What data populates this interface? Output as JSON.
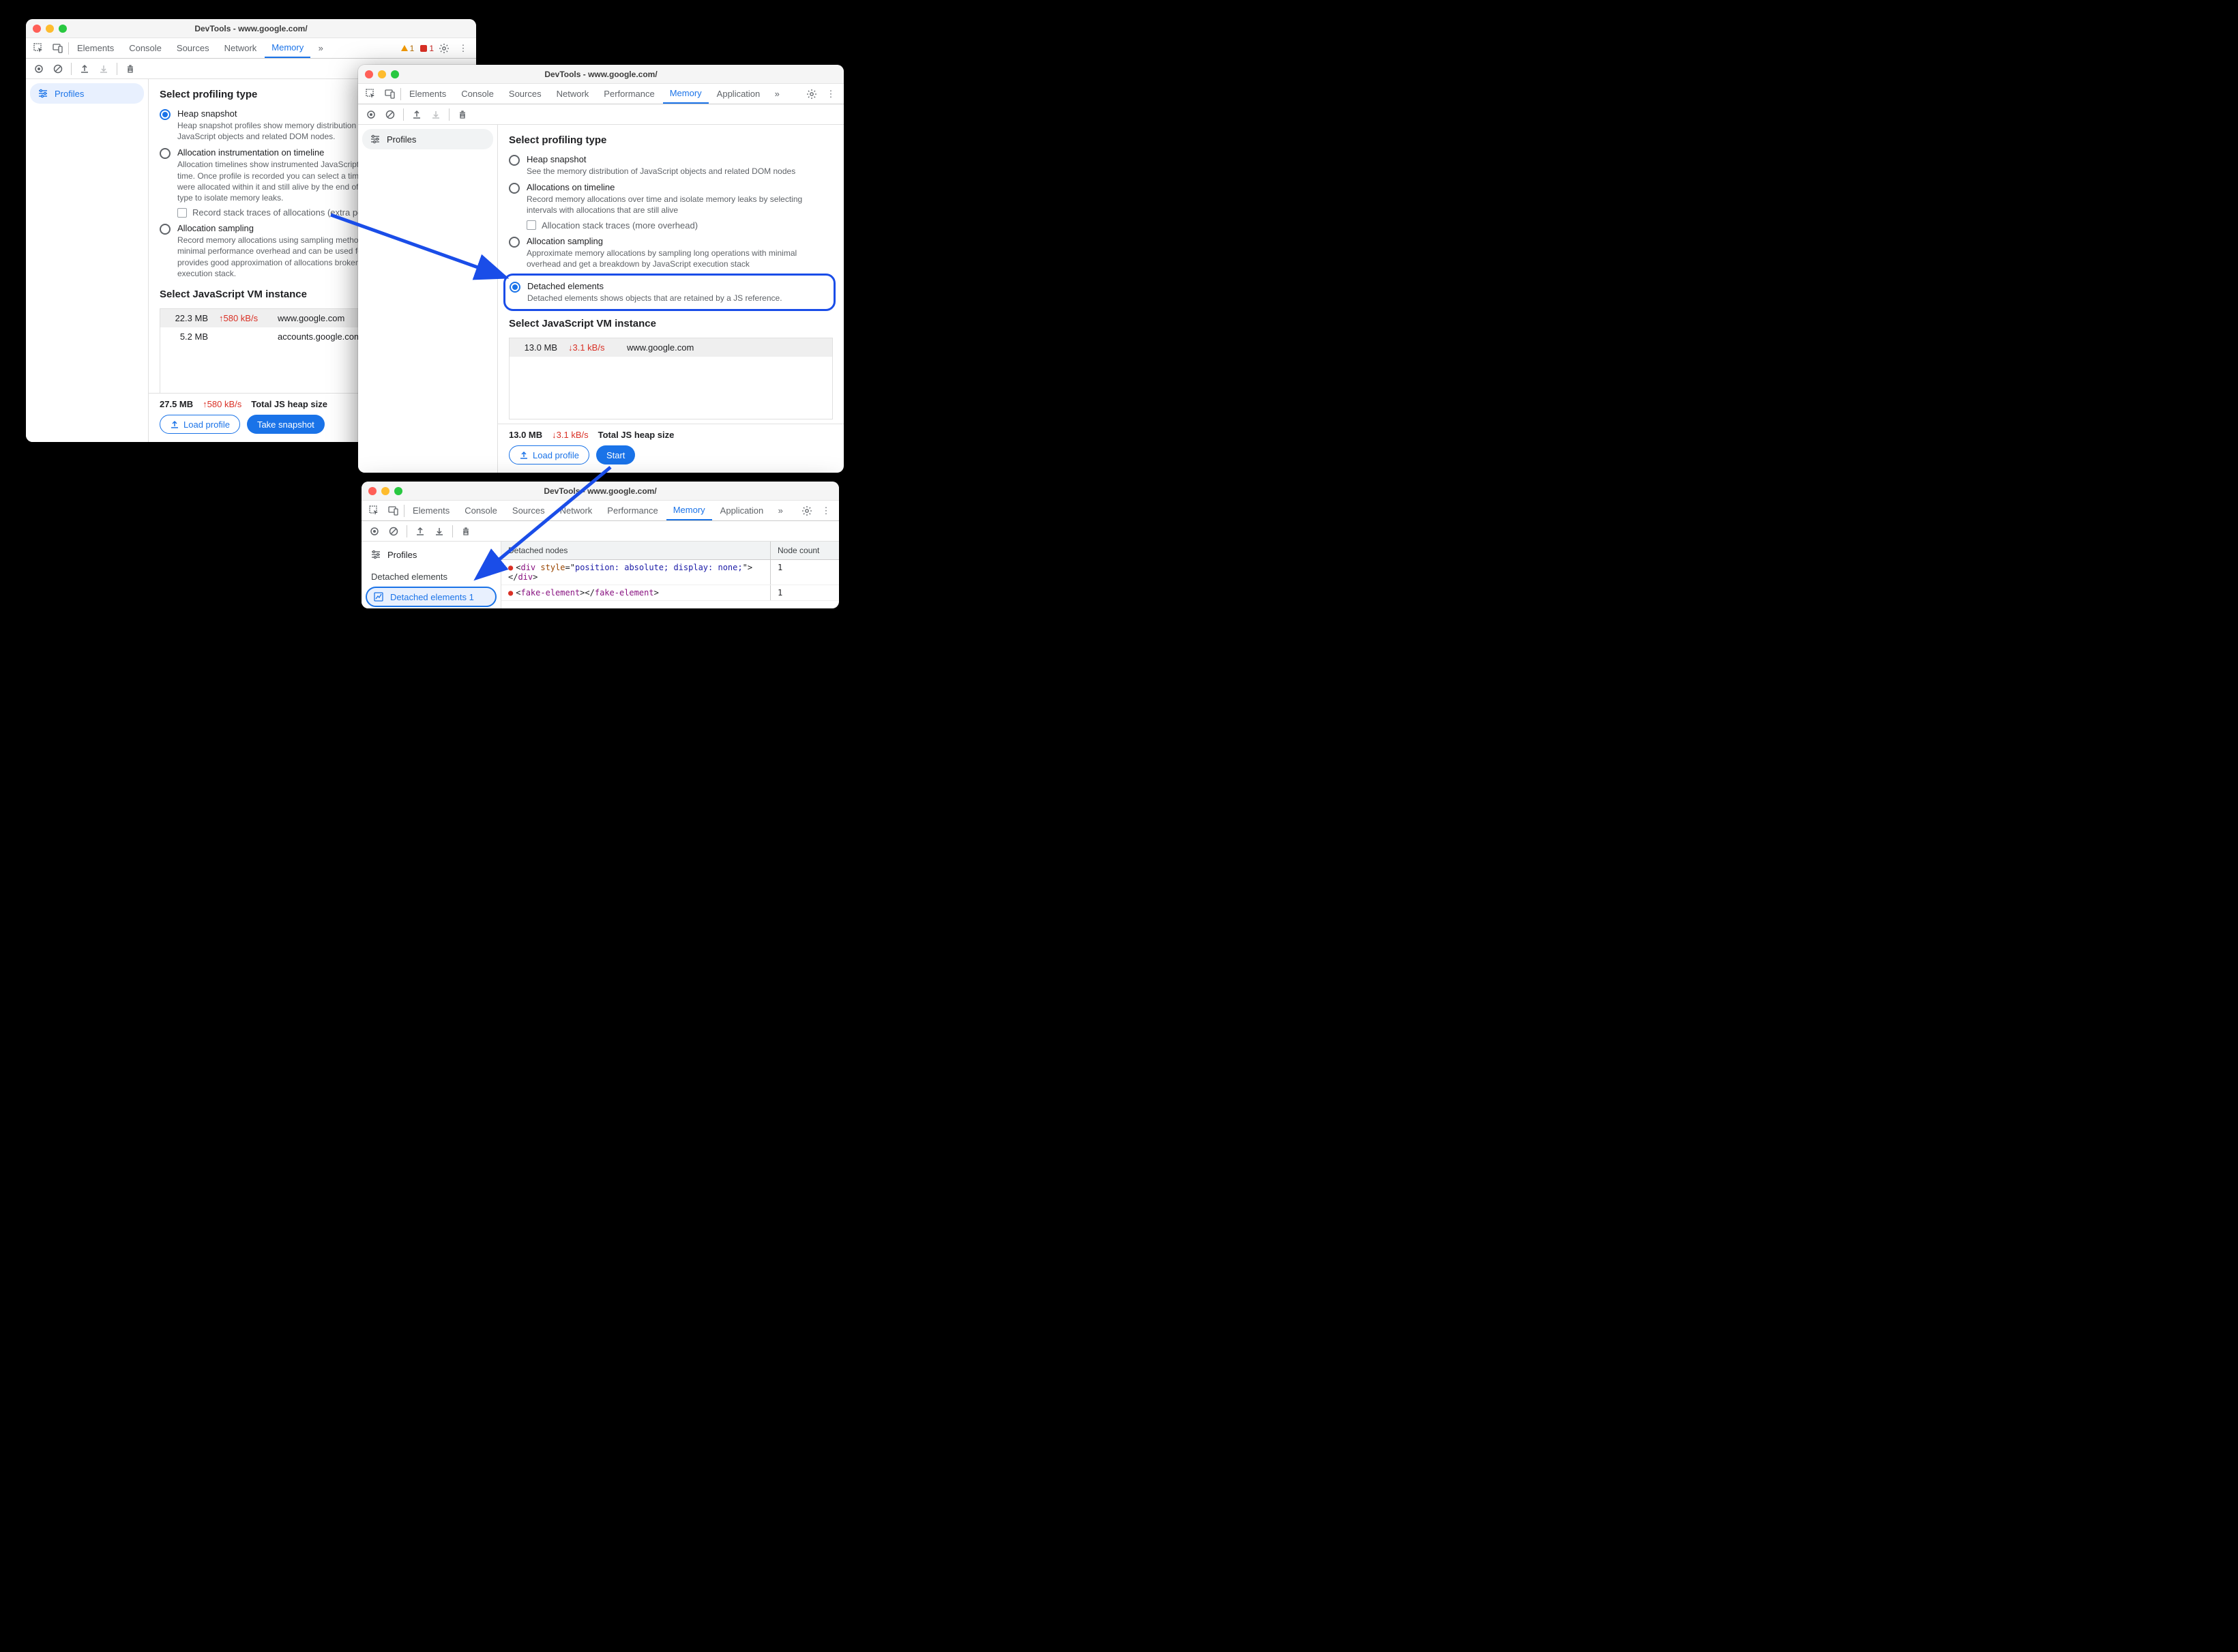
{
  "win1": {
    "title": "DevTools - www.google.com/",
    "tabs": [
      "Elements",
      "Console",
      "Sources",
      "Network",
      "Memory"
    ],
    "activeTab": "Memory",
    "warnCount": "1",
    "errCount": "1",
    "sidebar": {
      "profiles": "Profiles"
    },
    "sectTitle": "Select profiling type",
    "opt1": {
      "title": "Heap snapshot",
      "desc": "Heap snapshot profiles show memory distribution among your page's JavaScript objects and related DOM nodes."
    },
    "opt2": {
      "title": "Allocation instrumentation on timeline",
      "desc": "Allocation timelines show instrumented JavaScript memory allocations over time. Once profile is recorded you can select a time interval to see objects that were allocated within it and still alive by the end of recording. Use this profile type to isolate memory leaks.",
      "checkbox": "Record stack traces of allocations (extra performance overhead)"
    },
    "opt3": {
      "title": "Allocation sampling",
      "desc": "Record memory allocations using sampling method. This profile type has minimal performance overhead and can be used for long running operations. It provides good approximation of allocations broken down by JavaScript execution stack."
    },
    "vmTitle": "Select JavaScript VM instance",
    "vmRows": [
      {
        "size": "22.3 MB",
        "rate": "↑580 kB/s",
        "url": "www.google.com"
      },
      {
        "size": "5.2 MB",
        "rate": "",
        "url": "accounts.google.com: Root"
      }
    ],
    "footer": {
      "total": "27.5 MB",
      "rate": "↑580 kB/s",
      "label": "Total JS heap size",
      "load": "Load profile",
      "action": "Take snapshot"
    }
  },
  "win2": {
    "title": "DevTools - www.google.com/",
    "tabs": [
      "Elements",
      "Console",
      "Sources",
      "Network",
      "Performance",
      "Memory",
      "Application"
    ],
    "activeTab": "Memory",
    "sidebar": {
      "profiles": "Profiles"
    },
    "sectTitle": "Select profiling type",
    "opt1": {
      "title": "Heap snapshot",
      "desc": "See the memory distribution of JavaScript objects and related DOM nodes"
    },
    "opt2": {
      "title": "Allocations on timeline",
      "desc": "Record memory allocations over time and isolate memory leaks by selecting intervals with allocations that are still alive",
      "checkbox": "Allocation stack traces (more overhead)"
    },
    "opt3": {
      "title": "Allocation sampling",
      "desc": "Approximate memory allocations by sampling long operations with minimal overhead and get a breakdown by JavaScript execution stack"
    },
    "opt4": {
      "title": "Detached elements",
      "desc": "Detached elements shows objects that are retained by a JS reference."
    },
    "vmTitle": "Select JavaScript VM instance",
    "vmRows": [
      {
        "size": "13.0 MB",
        "rate": "↓3.1 kB/s",
        "url": "www.google.com"
      }
    ],
    "footer": {
      "total": "13.0 MB",
      "rate": "↓3.1 kB/s",
      "label": "Total JS heap size",
      "load": "Load profile",
      "action": "Start"
    }
  },
  "win3": {
    "title": "DevTools - www.google.com/",
    "tabs": [
      "Elements",
      "Console",
      "Sources",
      "Network",
      "Performance",
      "Memory",
      "Application"
    ],
    "activeTab": "Memory",
    "sidebar": {
      "profiles": "Profiles",
      "section": "Detached elements",
      "result": "Detached elements 1"
    },
    "columns": {
      "nodes": "Detached nodes",
      "count": "Node count"
    },
    "rows": [
      {
        "html_prefix": "<",
        "tag": "div",
        "space": " ",
        "attr_name": "style",
        "eq": "=\"",
        "attr_val": "position: absolute; display: none;",
        "close": "\"></",
        "end_tag": "div",
        "gt": ">",
        "count": "1"
      },
      {
        "html_prefix": "<",
        "tag": "fake-element",
        "mid": "></",
        "end_tag": "fake-element",
        "gt": ">",
        "count": "1"
      }
    ]
  }
}
